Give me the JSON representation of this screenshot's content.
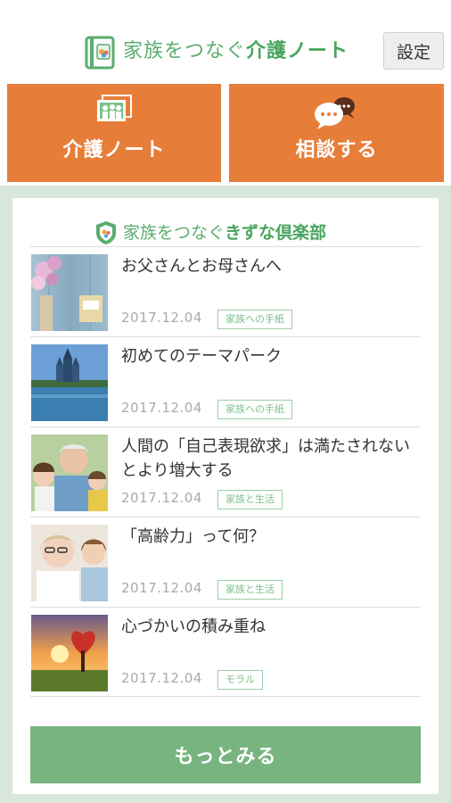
{
  "header": {
    "logo_icon": "notebook-logo-icon",
    "title_prefix": "家族をつなぐ",
    "title_strong": "介護ノート",
    "settings_label": "設定"
  },
  "actions": {
    "care_note": {
      "label": "介護ノート",
      "icon": "photo-album-icon"
    },
    "consult": {
      "label": "相談する",
      "icon": "chat-bubble-icon"
    }
  },
  "club": {
    "title_prefix": "家族をつなぐ",
    "title_strong": "きずな倶楽部",
    "icon": "shield-logo-icon",
    "articles": [
      {
        "title": "お父さんとお母さんへ",
        "date": "2017.12.04",
        "tag": "家族への手紙",
        "thumb": "flowers-letter"
      },
      {
        "title": "初めてのテーマパーク",
        "date": "2017.12.04",
        "tag": "家族への手紙",
        "thumb": "castle-lake"
      },
      {
        "title": "人間の「自己表現欲求」は満たされないとより増大する",
        "date": "2017.12.04",
        "tag": "家族と生活",
        "thumb": "grandfather-grandchild"
      },
      {
        "title": "「高齢力」って何？",
        "date": "2017.12.04",
        "tag": "家族と生活",
        "thumb": "women-smiling"
      },
      {
        "title": "心づかいの積み重ね",
        "date": "2017.12.04",
        "tag": "モラル",
        "thumb": "heart-tree-sunset"
      }
    ],
    "more_label": "もっとみる"
  },
  "colors": {
    "accent_orange": "#e67e3a",
    "brand_green": "#5aad6e",
    "more_button_green": "#77b47f",
    "panel_background": "#d9e6dc"
  }
}
